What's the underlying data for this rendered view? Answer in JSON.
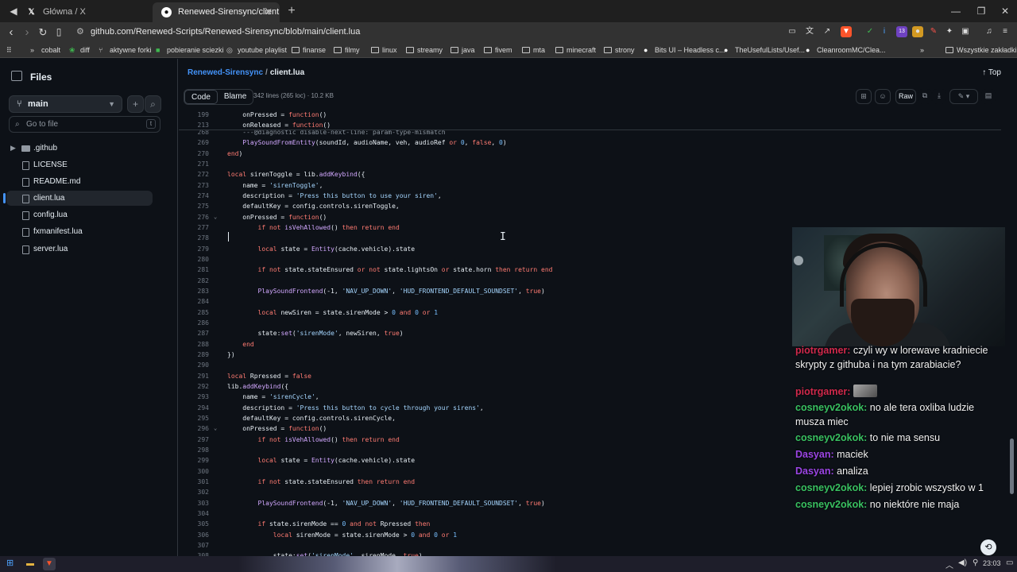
{
  "browser": {
    "tabs": [
      {
        "title": "Główna / X",
        "icon": "x-logo-icon"
      },
      {
        "title": "Renewed-Sirensync/client.lua at",
        "icon": "github-icon"
      }
    ],
    "url": "github.com/Renewed-Scripts/Renewed-Sirensync/blob/main/client.lua",
    "bookmarks": [
      "cobalt",
      "diff",
      "aktywne forki",
      "pobieranie sciezki",
      "youtube playlist",
      "finanse",
      "filmy",
      "linux",
      "streamy",
      "java",
      "fivem",
      "mta",
      "minecraft",
      "strony",
      "Bits UI – Headless c...",
      "TheUsefulLists/Usef...",
      "CleanroomMC/Clea..."
    ],
    "other_bookmarks": "Wszystkie zakładki",
    "ext_badge": "13"
  },
  "sidebar": {
    "title": "Files",
    "branch": "main",
    "search_placeholder": "Go to file",
    "search_shortcut": "t",
    "items": [
      {
        "label": ".github",
        "type": "dir"
      },
      {
        "label": "LICENSE",
        "type": "file"
      },
      {
        "label": "README.md",
        "type": "file"
      },
      {
        "label": "client.lua",
        "type": "file",
        "active": true
      },
      {
        "label": "config.lua",
        "type": "file"
      },
      {
        "label": "fxmanifest.lua",
        "type": "file"
      },
      {
        "label": "server.lua",
        "type": "file"
      }
    ]
  },
  "header": {
    "repo": "Renewed-Sirensync",
    "sep": "/",
    "file": "client.lua",
    "top": "Top",
    "tab_code": "Code",
    "tab_blame": "Blame",
    "stats": "342 lines (265 loc) · 10.2 KB",
    "raw": "Raw"
  },
  "code": {
    "sticky": [
      {
        "n": "199",
        "t": "    onPressed = function()"
      },
      {
        "n": "213",
        "t": "    onReleased = function()"
      }
    ],
    "lines": [
      {
        "n": "268",
        "t": "    ---@diagnostic disable-next-line: param-type-mismatch",
        "c": "cm"
      },
      {
        "n": "269",
        "t": "    PlaySoundFromEntity(soundId, audioName, veh, audioRef or 0, false, 0)"
      },
      {
        "n": "270",
        "t": "end)"
      },
      {
        "n": "271",
        "t": ""
      },
      {
        "n": "272",
        "t": "local sirenToggle = lib.addKeybind({"
      },
      {
        "n": "273",
        "t": "    name = 'sirenToggle',"
      },
      {
        "n": "274",
        "t": "    description = 'Press this button to use your siren',"
      },
      {
        "n": "275",
        "t": "    defaultKey = config.controls.sirenToggle,"
      },
      {
        "n": "276",
        "t": "    onPressed = function()",
        "fold": true
      },
      {
        "n": "277",
        "t": "        if not isVehAllowed() then return end"
      },
      {
        "n": "278",
        "t": ""
      },
      {
        "n": "279",
        "t": "        local state = Entity(cache.vehicle).state"
      },
      {
        "n": "280",
        "t": ""
      },
      {
        "n": "281",
        "t": "        if not state.stateEnsured or not state.lightsOn or state.horn then return end"
      },
      {
        "n": "282",
        "t": ""
      },
      {
        "n": "283",
        "t": "        PlaySoundFrontend(-1, 'NAV_UP_DOWN', 'HUD_FRONTEND_DEFAULT_SOUNDSET', true)"
      },
      {
        "n": "284",
        "t": ""
      },
      {
        "n": "285",
        "t": "        local newSiren = state.sirenMode > 0 and 0 or 1"
      },
      {
        "n": "286",
        "t": ""
      },
      {
        "n": "287",
        "t": "        state:set('sirenMode', newSiren, true)"
      },
      {
        "n": "288",
        "t": "    end"
      },
      {
        "n": "289",
        "t": "})"
      },
      {
        "n": "290",
        "t": ""
      },
      {
        "n": "291",
        "t": "local Rpressed = false"
      },
      {
        "n": "292",
        "t": "lib.addKeybind({"
      },
      {
        "n": "293",
        "t": "    name = 'sirenCycle',"
      },
      {
        "n": "294",
        "t": "    description = 'Press this button to cycle through your sirens',"
      },
      {
        "n": "295",
        "t": "    defaultKey = config.controls.sirenCycle,"
      },
      {
        "n": "296",
        "t": "    onPressed = function()",
        "fold": true
      },
      {
        "n": "297",
        "t": "        if not isVehAllowed() then return end"
      },
      {
        "n": "298",
        "t": ""
      },
      {
        "n": "299",
        "t": "        local state = Entity(cache.vehicle).state"
      },
      {
        "n": "300",
        "t": ""
      },
      {
        "n": "301",
        "t": "        if not state.stateEnsured then return end"
      },
      {
        "n": "302",
        "t": ""
      },
      {
        "n": "303",
        "t": "        PlaySoundFrontend(-1, 'NAV_UP_DOWN', 'HUD_FRONTEND_DEFAULT_SOUNDSET', true)"
      },
      {
        "n": "304",
        "t": ""
      },
      {
        "n": "305",
        "t": "        if state.sirenMode == 0 and not Rpressed then"
      },
      {
        "n": "306",
        "t": "            local sirenMode = state.sirenMode > 0 and 0 or 1"
      },
      {
        "n": "307",
        "t": ""
      },
      {
        "n": "308",
        "t": "            state:set('sirenMode', sirenMode, true)"
      }
    ]
  },
  "chat": [
    {
      "user": "piotrgamer",
      "color": "u-red",
      "msg": " czyli wy w lorewave kradniecie skrypty z githuba i na tym zarabiacie?",
      "cut": true
    },
    {
      "user": "piotrgamer",
      "color": "u-red",
      "msg": "",
      "emote": true
    },
    {
      "user": "cosneyv2okok",
      "color": "u-green",
      "msg": " no ale tera oxliba ludzie musza miec"
    },
    {
      "user": "cosneyv2okok",
      "color": "u-green",
      "msg": " to nie ma sensu"
    },
    {
      "user": "Dasyan",
      "color": "u-purple",
      "msg": " maciek"
    },
    {
      "user": "Dasyan",
      "color": "u-purple",
      "msg": " analiza"
    },
    {
      "user": "cosneyv2okok",
      "color": "u-green",
      "msg": " lepiej zrobic wszystko w 1"
    },
    {
      "user": "cosneyv2okok",
      "color": "u-green",
      "msg": " no niektóre nie maja"
    }
  ],
  "taskbar": {
    "time": "23:03"
  }
}
